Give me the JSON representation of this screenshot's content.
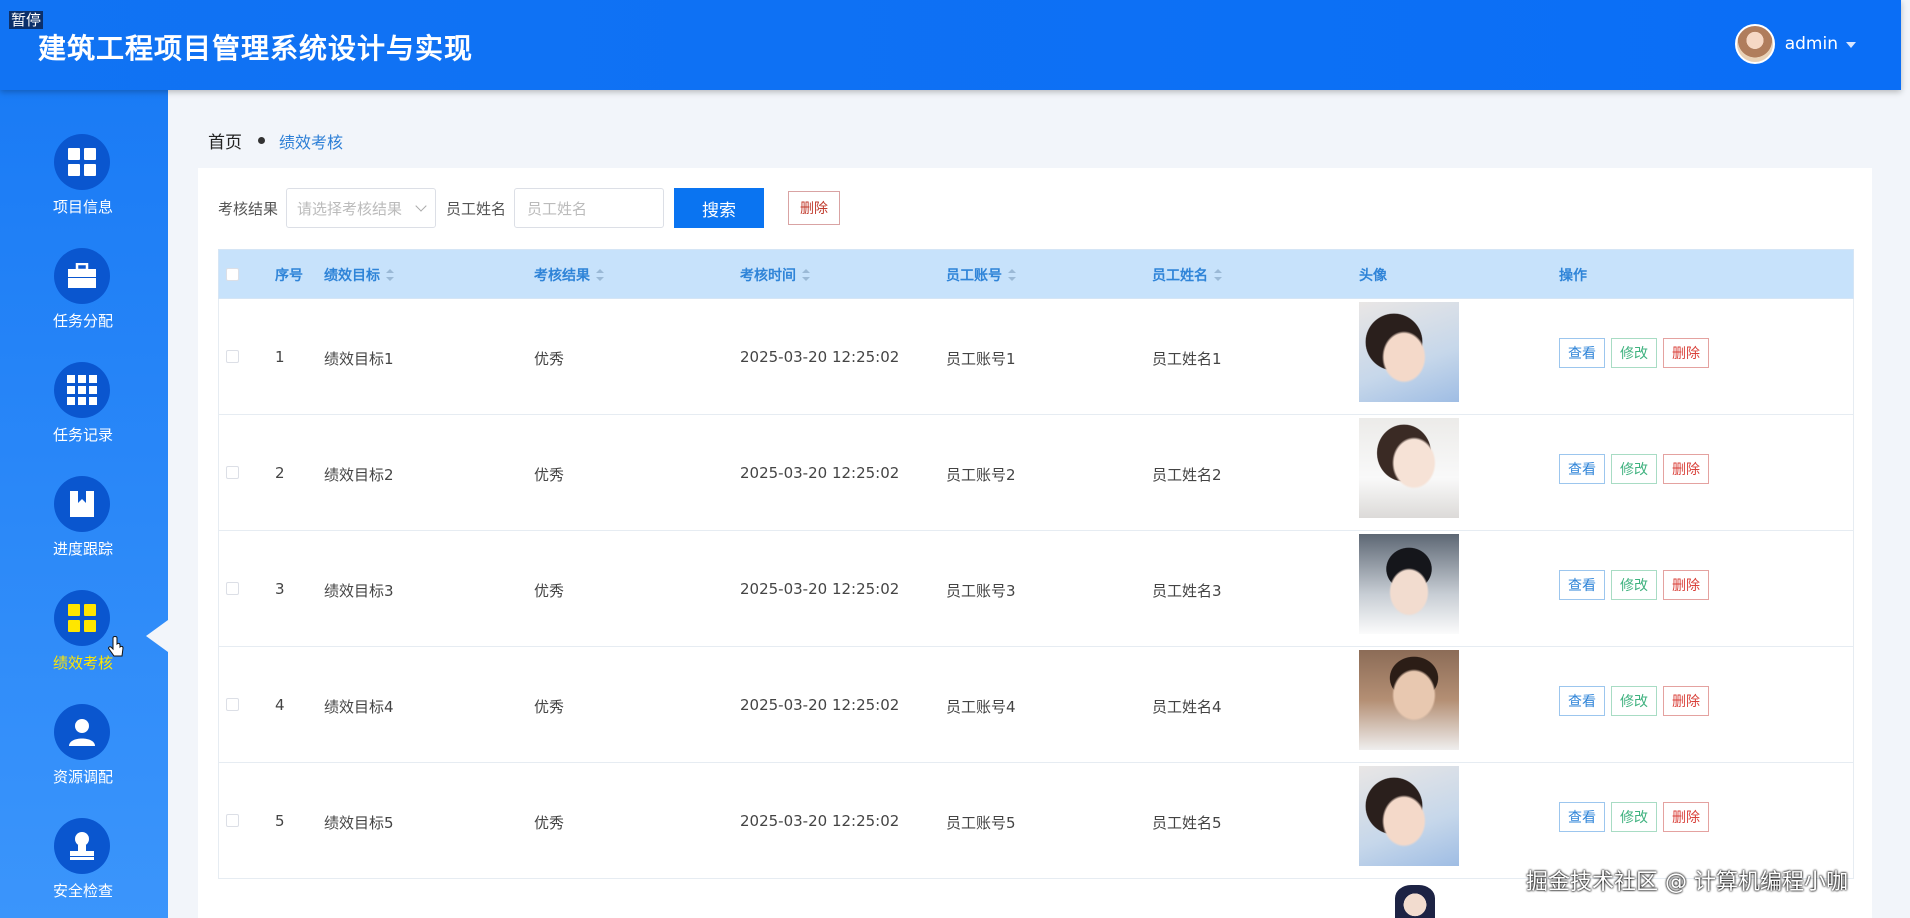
{
  "overlay": {
    "paused_label": "暂停"
  },
  "header": {
    "title": "建筑工程项目管理系统设计与实现",
    "username": "admin"
  },
  "sidebar": {
    "items": [
      {
        "label": "项目信息",
        "icon": "grid-icon"
      },
      {
        "label": "任务分配",
        "icon": "briefcase-icon"
      },
      {
        "label": "任务记录",
        "icon": "grid-nine-icon"
      },
      {
        "label": "进度跟踪",
        "icon": "book-icon"
      },
      {
        "label": "绩效考核",
        "icon": "grid-icon",
        "active": true
      },
      {
        "label": "资源调配",
        "icon": "user-icon"
      },
      {
        "label": "安全检查",
        "icon": "stamp-icon"
      }
    ],
    "active_color": "#ffe600"
  },
  "breadcrumb": {
    "home": "首页",
    "current": "绩效考核"
  },
  "filter": {
    "result_label": "考核结果",
    "result_placeholder": "请选择考核结果",
    "name_label": "员工姓名",
    "name_placeholder": "员工姓名",
    "search_label": "搜索",
    "delete_label": "删除"
  },
  "table": {
    "headers": [
      "序号",
      "绩效目标",
      "考核结果",
      "考核时间",
      "员工账号",
      "员工姓名",
      "头像",
      "操作"
    ],
    "rows": [
      {
        "index": "1",
        "goal": "绩效目标1",
        "result": "优秀",
        "time": "2025-03-20 12:25:02",
        "account": "员工账号1",
        "name": "员工姓名1"
      },
      {
        "index": "2",
        "goal": "绩效目标2",
        "result": "优秀",
        "time": "2025-03-20 12:25:02",
        "account": "员工账号2",
        "name": "员工姓名2"
      },
      {
        "index": "3",
        "goal": "绩效目标3",
        "result": "优秀",
        "time": "2025-03-20 12:25:02",
        "account": "员工账号3",
        "name": "员工姓名3"
      },
      {
        "index": "4",
        "goal": "绩效目标4",
        "result": "优秀",
        "time": "2025-03-20 12:25:02",
        "account": "员工账号4",
        "name": "员工姓名4"
      },
      {
        "index": "5",
        "goal": "绩效目标5",
        "result": "优秀",
        "time": "2025-03-20 12:25:02",
        "account": "员工账号5",
        "name": "员工姓名5"
      }
    ],
    "actions": {
      "view": "查看",
      "edit": "修改",
      "delete": "删除"
    }
  },
  "watermark": "掘金技术社区 @ 计算机编程小咖",
  "colors": {
    "header": "#0a6ef6",
    "sidebar": "#1a7bf5",
    "search_button": "#0a74f1",
    "table_header": "#c7e2fb"
  }
}
